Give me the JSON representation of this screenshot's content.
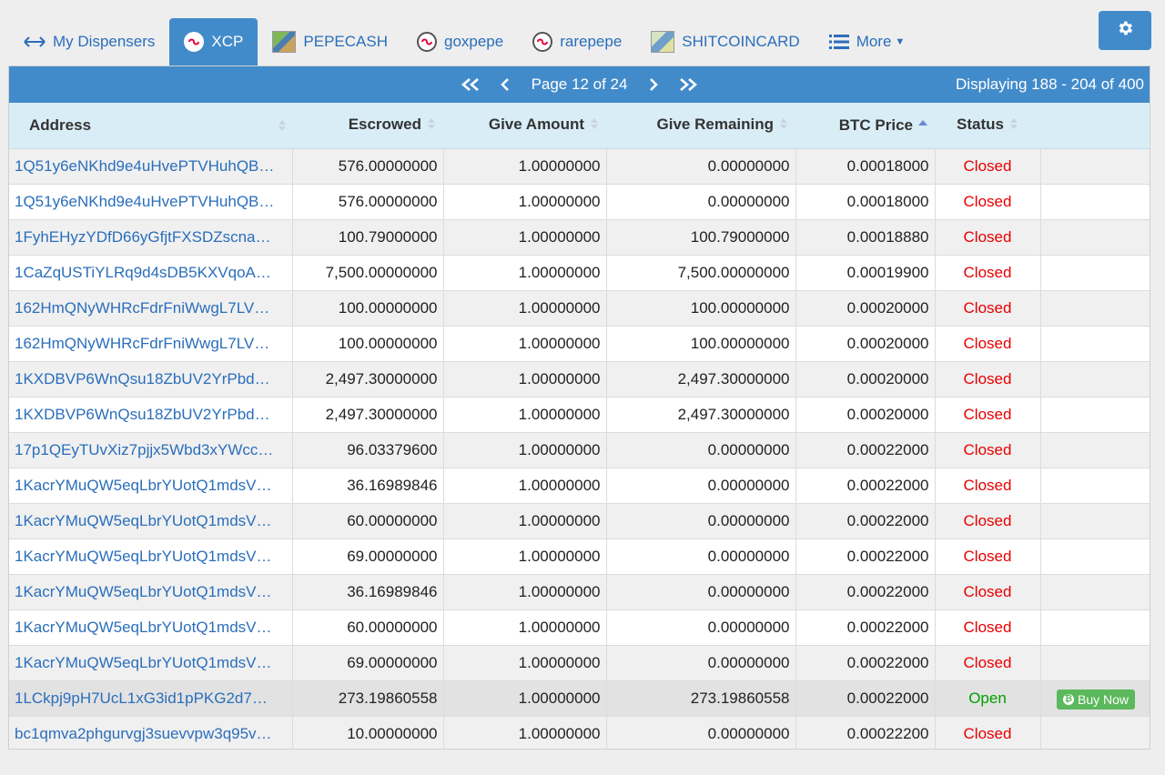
{
  "tabs": [
    {
      "label": "My Dispensers",
      "icon": "arrows-horizontal-icon"
    },
    {
      "label": "XCP",
      "icon": "xcp-logo-icon",
      "active": true
    },
    {
      "label": "PEPECASH",
      "icon": "pepecash-thumbnail-icon"
    },
    {
      "label": "goxpepe",
      "icon": "xcp-logo-icon"
    },
    {
      "label": "rarepepe",
      "icon": "xcp-logo-icon"
    },
    {
      "label": "SHITCOINCARD",
      "icon": "shitcoincard-thumbnail-icon"
    },
    {
      "label": "More",
      "icon": "list-icon"
    }
  ],
  "settings": {
    "icon": "gear-icon"
  },
  "pager": {
    "page_label": "Page 12 of 24",
    "displaying": "Displaying 188 - 204 of 400"
  },
  "columns": [
    "Address",
    "Escrowed",
    "Give Amount",
    "Give Remaining",
    "BTC Price",
    "Status"
  ],
  "sort": {
    "column": "BTC Price",
    "direction": "asc"
  },
  "colors": {
    "accent": "#428bca",
    "header_bg": "#d9edf7",
    "closed": "#e60000",
    "open": "#00a000",
    "buy": "#5cb85c"
  },
  "buy_label": "Buy Now",
  "rows": [
    {
      "address": "1Q51y6eNKhd9e4uHvePTVHuhQB…",
      "escrowed": "576.00000000",
      "give_amount": "1.00000000",
      "give_remaining": "0.00000000",
      "btc_price": "0.00018000",
      "status": "Closed"
    },
    {
      "address": "1Q51y6eNKhd9e4uHvePTVHuhQB…",
      "escrowed": "576.00000000",
      "give_amount": "1.00000000",
      "give_remaining": "0.00000000",
      "btc_price": "0.00018000",
      "status": "Closed"
    },
    {
      "address": "1FyhEHyzYDfD66yGfjtFXSDZscna…",
      "escrowed": "100.79000000",
      "give_amount": "1.00000000",
      "give_remaining": "100.79000000",
      "btc_price": "0.00018880",
      "status": "Closed"
    },
    {
      "address": "1CaZqUSTiYLRq9d4sDB5KXVqoA…",
      "escrowed": "7,500.00000000",
      "give_amount": "1.00000000",
      "give_remaining": "7,500.00000000",
      "btc_price": "0.00019900",
      "status": "Closed"
    },
    {
      "address": "162HmQNyWHRcFdrFniWwgL7LV…",
      "escrowed": "100.00000000",
      "give_amount": "1.00000000",
      "give_remaining": "100.00000000",
      "btc_price": "0.00020000",
      "status": "Closed"
    },
    {
      "address": "162HmQNyWHRcFdrFniWwgL7LV…",
      "escrowed": "100.00000000",
      "give_amount": "1.00000000",
      "give_remaining": "100.00000000",
      "btc_price": "0.00020000",
      "status": "Closed"
    },
    {
      "address": "1KXDBVP6WnQsu18ZbUV2YrPbd…",
      "escrowed": "2,497.30000000",
      "give_amount": "1.00000000",
      "give_remaining": "2,497.30000000",
      "btc_price": "0.00020000",
      "status": "Closed"
    },
    {
      "address": "1KXDBVP6WnQsu18ZbUV2YrPbd…",
      "escrowed": "2,497.30000000",
      "give_amount": "1.00000000",
      "give_remaining": "2,497.30000000",
      "btc_price": "0.00020000",
      "status": "Closed"
    },
    {
      "address": "17p1QEyTUvXiz7pjjx5Wbd3xYWcc…",
      "escrowed": "96.03379600",
      "give_amount": "1.00000000",
      "give_remaining": "0.00000000",
      "btc_price": "0.00022000",
      "status": "Closed"
    },
    {
      "address": "1KacrYMuQW5eqLbrYUotQ1mdsV…",
      "escrowed": "36.16989846",
      "give_amount": "1.00000000",
      "give_remaining": "0.00000000",
      "btc_price": "0.00022000",
      "status": "Closed"
    },
    {
      "address": "1KacrYMuQW5eqLbrYUotQ1mdsV…",
      "escrowed": "60.00000000",
      "give_amount": "1.00000000",
      "give_remaining": "0.00000000",
      "btc_price": "0.00022000",
      "status": "Closed"
    },
    {
      "address": "1KacrYMuQW5eqLbrYUotQ1mdsV…",
      "escrowed": "69.00000000",
      "give_amount": "1.00000000",
      "give_remaining": "0.00000000",
      "btc_price": "0.00022000",
      "status": "Closed"
    },
    {
      "address": "1KacrYMuQW5eqLbrYUotQ1mdsV…",
      "escrowed": "36.16989846",
      "give_amount": "1.00000000",
      "give_remaining": "0.00000000",
      "btc_price": "0.00022000",
      "status": "Closed"
    },
    {
      "address": "1KacrYMuQW5eqLbrYUotQ1mdsV…",
      "escrowed": "60.00000000",
      "give_amount": "1.00000000",
      "give_remaining": "0.00000000",
      "btc_price": "0.00022000",
      "status": "Closed"
    },
    {
      "address": "1KacrYMuQW5eqLbrYUotQ1mdsV…",
      "escrowed": "69.00000000",
      "give_amount": "1.00000000",
      "give_remaining": "0.00000000",
      "btc_price": "0.00022000",
      "status": "Closed"
    },
    {
      "address": "1LCkpj9pH7UcL1xG3id1pPKG2d7…",
      "escrowed": "273.19860558",
      "give_amount": "1.00000000",
      "give_remaining": "273.19860558",
      "btc_price": "0.00022000",
      "status": "Open",
      "buy": true
    },
    {
      "address": "bc1qmva2phgurvgj3suevvpw3q95v…",
      "escrowed": "10.00000000",
      "give_amount": "1.00000000",
      "give_remaining": "0.00000000",
      "btc_price": "0.00022200",
      "status": "Closed"
    }
  ]
}
